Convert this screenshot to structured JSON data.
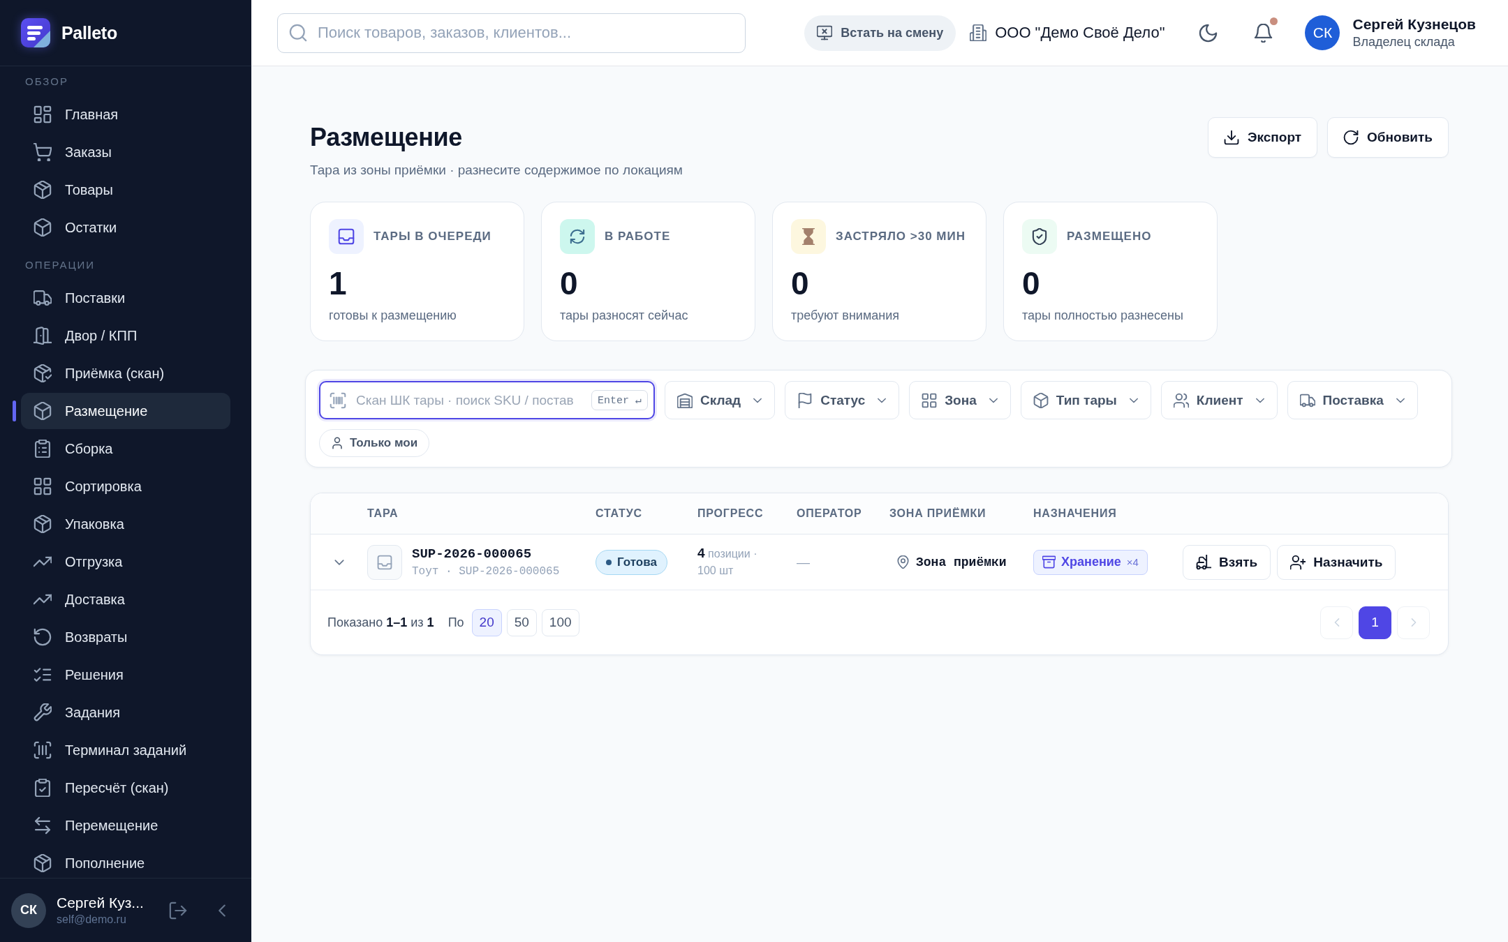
{
  "sidebar": {
    "logo": {
      "text": "Palleto"
    },
    "sections": [
      {
        "title": "ОБЗОР",
        "items": [
          {
            "label": "Главная",
            "selected": false
          },
          {
            "label": "Заказы",
            "selected": false
          },
          {
            "label": "Товары",
            "selected": false
          },
          {
            "label": "Остатки",
            "selected": false
          }
        ]
      },
      {
        "title": "ОПЕРАЦИИ",
        "items": [
          {
            "label": "Поставки",
            "selected": false
          },
          {
            "label": "Двор / КПП",
            "selected": false
          },
          {
            "label": "Приёмка (скан)",
            "selected": false
          },
          {
            "label": "Размещение",
            "selected": true
          },
          {
            "label": "Сборка",
            "selected": false
          },
          {
            "label": "Сортировка",
            "selected": false
          },
          {
            "label": "Упаковка",
            "selected": false
          },
          {
            "label": "Отгрузка",
            "selected": false
          },
          {
            "label": "Доставка",
            "selected": false
          },
          {
            "label": "Возвраты",
            "selected": false
          },
          {
            "label": "Решения",
            "selected": false
          },
          {
            "label": "Задания",
            "selected": false
          },
          {
            "label": "Терминал заданий",
            "selected": false
          },
          {
            "label": "Пересчёт (скан)",
            "selected": false
          },
          {
            "label": "Перемещение",
            "selected": false
          },
          {
            "label": "Пополнение",
            "selected": false
          }
        ]
      }
    ],
    "user": {
      "initials": "СК",
      "name": "Сергей Куз...",
      "email": "self@demo.ru"
    }
  },
  "topbar": {
    "search": {
      "placeholder": "Поиск товаров, заказов, клиентов..."
    },
    "shift_button": "Встать на смену",
    "company": "ООО \"Демо Своё Дело\"",
    "notifications": {
      "unread": true
    },
    "user": {
      "initials": "СК",
      "name": "Сергей Кузнецов",
      "role": "Владелец склада"
    }
  },
  "page": {
    "title": "Размещение",
    "subtitle": "Тара из зоны приёмки · разнесите содержимое по локациям",
    "actions": [
      "Экспорт",
      "Обновить"
    ]
  },
  "stats": [
    {
      "label": "ТАРЫ В ОЧЕРЕДИ",
      "value": "1",
      "caption": "готовы к размещению"
    },
    {
      "label": "В РАБОТЕ",
      "value": "0",
      "caption": "тары разносят сейчас"
    },
    {
      "label": "ЗАСТРЯЛО >30 МИН",
      "value": "0",
      "caption": "требуют внимания"
    },
    {
      "label": "РАЗМЕЩЕНО",
      "value": "0",
      "caption": "тары полностью разнесены"
    }
  ],
  "filters": {
    "scan": {
      "placeholder": "Скан ШК тары · поиск SKU / постав",
      "hint": "Enter ↵",
      "focused": true
    },
    "dropdowns": [
      "Склад",
      "Статус",
      "Зона",
      "Тип тары",
      "Клиент",
      "Поставка"
    ],
    "only_mine": {
      "label": "Только мои",
      "on": false
    }
  },
  "table": {
    "columns": [
      "ТАРА",
      "СТАТУС",
      "ПРОГРЕСС",
      "ОПЕРАТОР",
      "ЗОНА ПРИЁМКИ",
      "НАЗНАЧЕНИЯ"
    ],
    "rows": [
      {
        "expanded": false,
        "code": "SUP-2026-000065",
        "subtitle": "Тоут · SUP-2026-000065",
        "status": "Готова",
        "progress": "**4** позиции · 100 шт",
        "operator": "—",
        "zone": "Зона приёмки",
        "assignment": {
          "label": "Хранение",
          "count": "×4"
        },
        "actions": [
          "Взять",
          "Назначить"
        ]
      }
    ],
    "footer": {
      "summary": "Показано **1–1** из **1**",
      "page_size_label": "По",
      "page_sizes": [
        {
          "label": "20",
          "selected": true
        },
        {
          "label": "50",
          "selected": false
        },
        {
          "label": "100",
          "selected": false
        }
      ],
      "prev_disabled": true,
      "pages": [
        {
          "label": "1",
          "selected": true
        }
      ],
      "next_disabled": true
    }
  }
}
